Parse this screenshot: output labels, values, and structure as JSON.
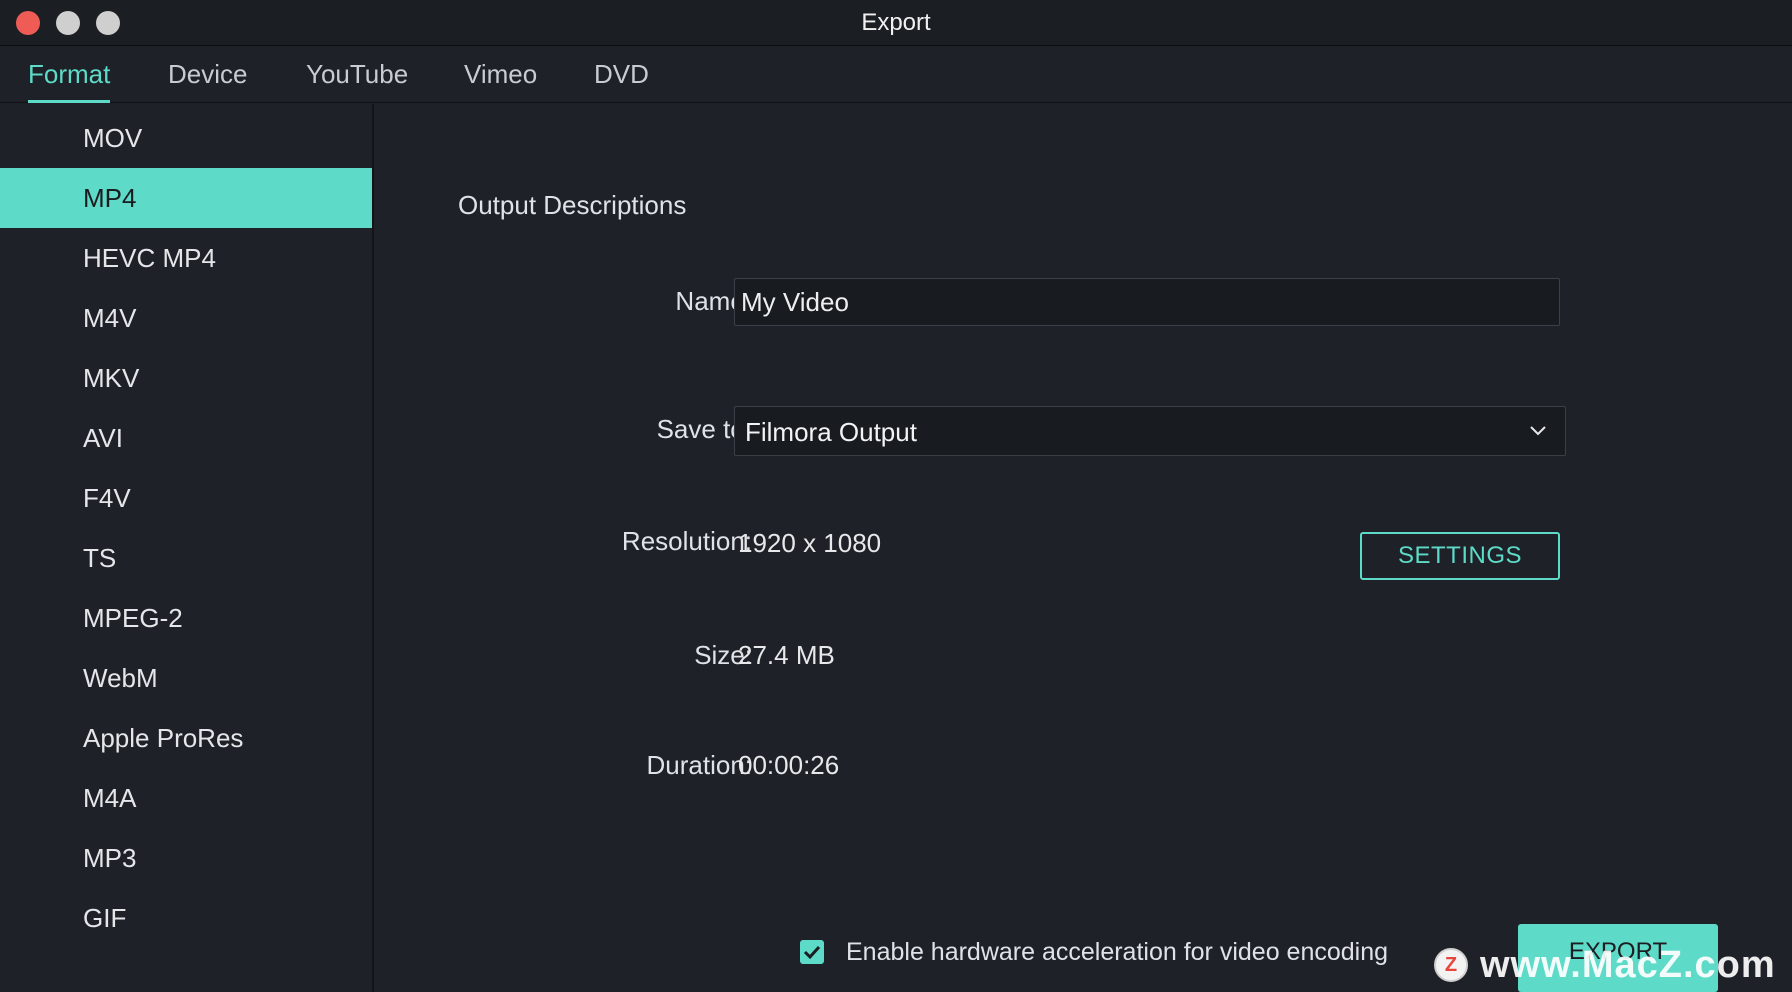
{
  "window": {
    "title": "Export"
  },
  "tabs": [
    {
      "label": "Format",
      "active": true
    },
    {
      "label": "Device"
    },
    {
      "label": "YouTube"
    },
    {
      "label": "Vimeo"
    },
    {
      "label": "DVD"
    }
  ],
  "formats": [
    "MOV",
    "MP4",
    "HEVC MP4",
    "M4V",
    "MKV",
    "AVI",
    "F4V",
    "TS",
    "MPEG-2",
    "WebM",
    "Apple ProRes",
    "M4A",
    "MP3",
    "GIF"
  ],
  "selected_format": "MP4",
  "output": {
    "section_title": "Output Descriptions",
    "name_label": "Name:",
    "name_value": "My Video",
    "save_label": "Save to:",
    "save_value": "Filmora Output",
    "resolution_label": "Resolution:",
    "resolution_value": "1920 x 1080",
    "settings_button": "SETTINGS",
    "size_label": "Size:",
    "size_value": "27.4 MB",
    "duration_label": "Duration:",
    "duration_value": "00:00:26"
  },
  "footer": {
    "hw_accel_label": "Enable hardware acceleration for video encoding",
    "hw_accel_checked": true,
    "export_button": "EXPORT"
  },
  "watermark": {
    "logo_letter": "Z",
    "text": "www.MacZ.com"
  },
  "colors": {
    "accent": "#5edac8",
    "background": "#1e2228",
    "close": "#ee5c55"
  }
}
